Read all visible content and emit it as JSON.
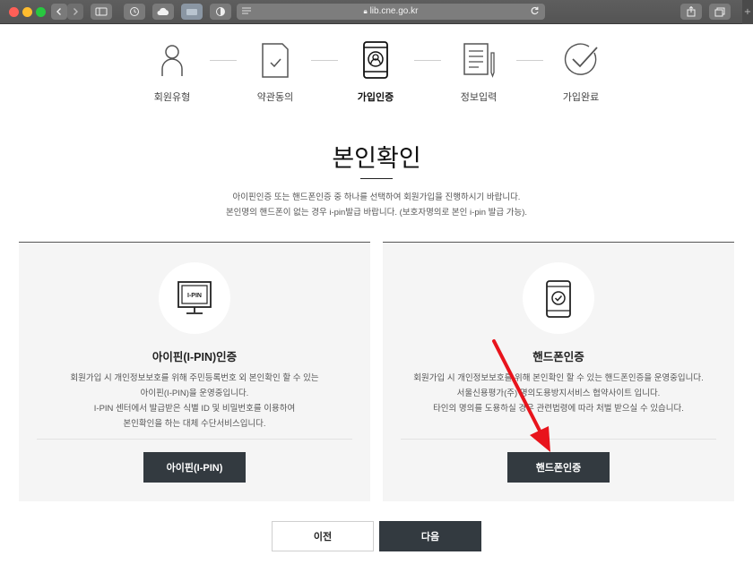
{
  "browser": {
    "url": "lib.cne.go.kr",
    "icons": [
      "back-icon",
      "forward-icon",
      "sidebar-icon",
      "history-icon",
      "cloud-icon",
      "tab-icon",
      "shield-icon",
      "lock-icon",
      "reload-icon",
      "share-icon",
      "tabs-overview-icon",
      "plus-icon"
    ]
  },
  "steps": [
    {
      "label": "회원유형",
      "icon": "person-icon",
      "active": false
    },
    {
      "label": "약관동의",
      "icon": "document-check-icon",
      "active": false
    },
    {
      "label": "가입인증",
      "icon": "phone-profile-icon",
      "active": true
    },
    {
      "label": "정보입력",
      "icon": "form-edit-icon",
      "active": false
    },
    {
      "label": "가입완료",
      "icon": "check-circle-icon",
      "active": false
    }
  ],
  "page": {
    "title": "본인확인",
    "desc1": "아이핀인증 또는 핸드폰인증 중 하나를 선택하여 회원가입을 진행하시기 바랍니다.",
    "desc2": "본인명의 핸드폰이 없는 경우 i-pin발급 바랍니다. (보호자명의로 본인 i-pin 발급 가능)."
  },
  "ipin": {
    "icon_text": "I-PIN",
    "title": "아이핀(I-PIN)인증",
    "lines": [
      "회원가입 시 개인정보보호를 위해 주민등록번호 외 본인확인 할 수 있는",
      "아이핀(I-PIN)을 운영중입니다.",
      "I-PIN 센터에서 발급받은 식별 ID 및 비밀번호를 이용하여",
      "본인확인을 하는 대체 수단서비스입니다."
    ],
    "button": "아이핀(I-PIN)"
  },
  "phone": {
    "title": "핸드폰인증",
    "lines": [
      "회원가입 시 개인정보보호를 위해 본인확인 할 수 있는 핸드폰인증을 운영중입니다.",
      "서울신용평가(주) 명의도용방지서비스 협약사이트 입니다.",
      "타인의 명의를 도용하실 경우 관련법령에 따라 처벌 받으실 수 있습니다."
    ],
    "button": "핸드폰인증"
  },
  "nav": {
    "prev": "이전",
    "next": "다음"
  },
  "colors": {
    "button_dark": "#333a40",
    "card_bg": "#f5f5f5",
    "annotation_arrow": "#e8141c"
  }
}
